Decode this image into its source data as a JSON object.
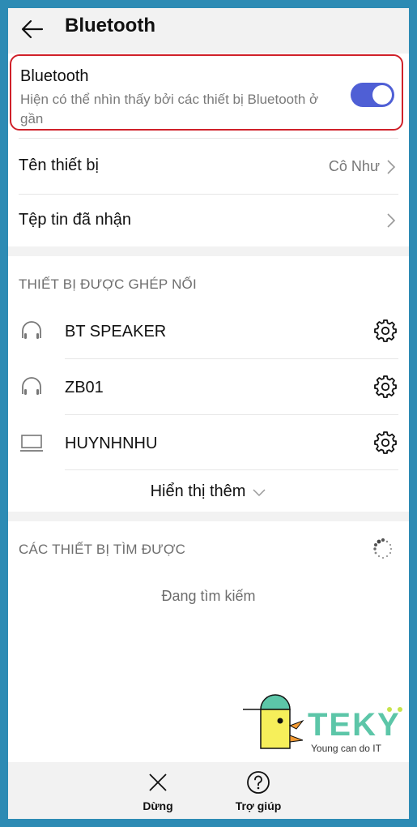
{
  "appbar": {
    "title": "Bluetooth",
    "back_icon": "arrow-left-icon"
  },
  "bluetooth_toggle": {
    "title": "Bluetooth",
    "subtitle": "Hiện có thể nhìn thấy bởi các thiết bị Bluetooth ở gần",
    "enabled": true,
    "highlight_color": "#d0212a",
    "toggle_color": "#4f5fd5"
  },
  "settings": [
    {
      "label": "Tên thiết bị",
      "value": "Cô Như"
    },
    {
      "label": "Tệp tin đã nhận",
      "value": ""
    }
  ],
  "paired": {
    "header": "THIẾT BỊ ĐƯỢC GHÉP NỐI",
    "devices": [
      {
        "name": "BT SPEAKER",
        "icon": "headphones-icon"
      },
      {
        "name": "ZB01",
        "icon": "headphones-icon"
      },
      {
        "name": "HUYNHNHU",
        "icon": "laptop-icon"
      }
    ],
    "show_more": "Hiển thị thêm"
  },
  "available": {
    "header": "CÁC THIẾT BỊ TÌM ĐƯỢC",
    "status": "Đang tìm kiếm"
  },
  "logo": {
    "brand": "TEKY",
    "tagline": "Young can do IT"
  },
  "bottom_bar": {
    "stop_label": "Dừng",
    "help_label": "Trợ giúp"
  },
  "colors": {
    "frame": "#2d8bb4",
    "bar_bg": "#f2f2f2",
    "brand_teal": "#5cc6a8"
  }
}
